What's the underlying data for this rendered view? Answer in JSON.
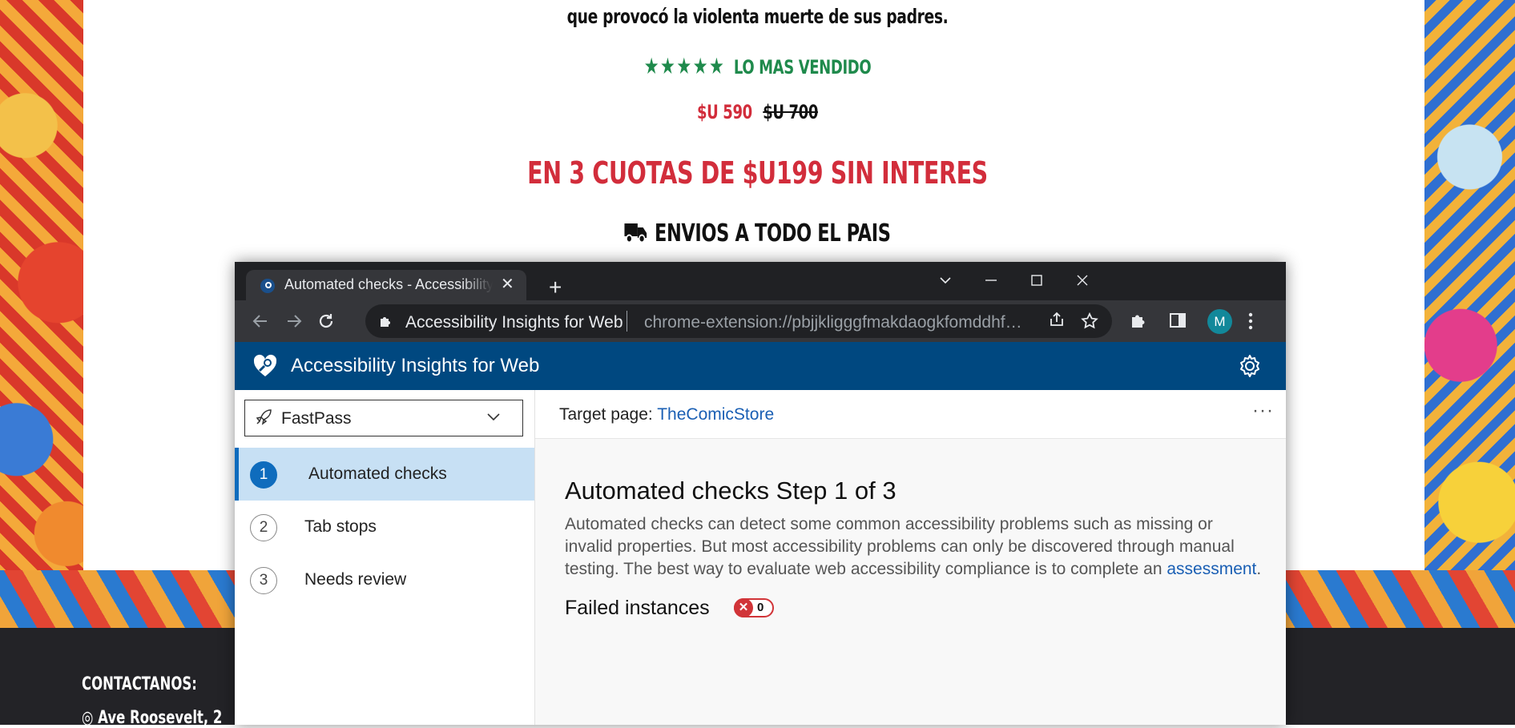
{
  "store": {
    "subtitle": "que provocó la violenta muerte de sus padres.",
    "stars": "★★★★★",
    "best_seller": "LO MAS VENDIDO",
    "price_new": "$U 590",
    "price_old": "$U 700",
    "installments": "EN 3 CUOTAS DE $U199 SIN INTERES",
    "shipping": "ENVIOS A TODO EL PAIS",
    "footer_title": "CONTACTANOS:",
    "footer_address": "◎ Ave Roosevelt, 2"
  },
  "browser": {
    "tab_title": "Automated checks - Accessibility Insights for Web",
    "tab_close": "✕",
    "new_tab": "+",
    "omnibox_title": "Accessibility Insights for Web",
    "omnibox_url": "chrome-extension://pbjjkligggfmakdaogkfomddhfmpjeni/DetailsView/detailsView.html",
    "avatar_letter": "M",
    "icons": [
      "tab-search-icon",
      "minimize-icon",
      "maximize-icon",
      "close-icon",
      "back-icon",
      "forward-icon",
      "reload-icon",
      "extension-icon",
      "share-icon",
      "star-icon",
      "puzzle-icon",
      "sidepanel-icon",
      "menu-icon"
    ]
  },
  "app": {
    "title": "Accessibility Insights for Web",
    "mode": "FastPass",
    "nav": [
      {
        "num": "1",
        "label": "Automated checks",
        "selected": true
      },
      {
        "num": "2",
        "label": "Tab stops",
        "selected": false
      },
      {
        "num": "3",
        "label": "Needs review",
        "selected": false
      }
    ],
    "target_label": "Target page:",
    "target_link": "TheComicStore",
    "more": "···",
    "step_title": "Automated checks Step 1 of 3",
    "step_desc": "Automated checks can detect some common accessibility problems such as missing or invalid properties. But most accessibility problems can only be discovered through manual testing. The best way to evaluate web accessibility compliance is to complete an",
    "step_desc_link": "assessment",
    "step_desc_end": ".",
    "failed_label": "Failed instances",
    "failed_count": "0",
    "colors": {
      "header": "#004880",
      "selected": "#c7e0f4",
      "accent": "#0f6cbd",
      "fail": "#d13438"
    }
  }
}
